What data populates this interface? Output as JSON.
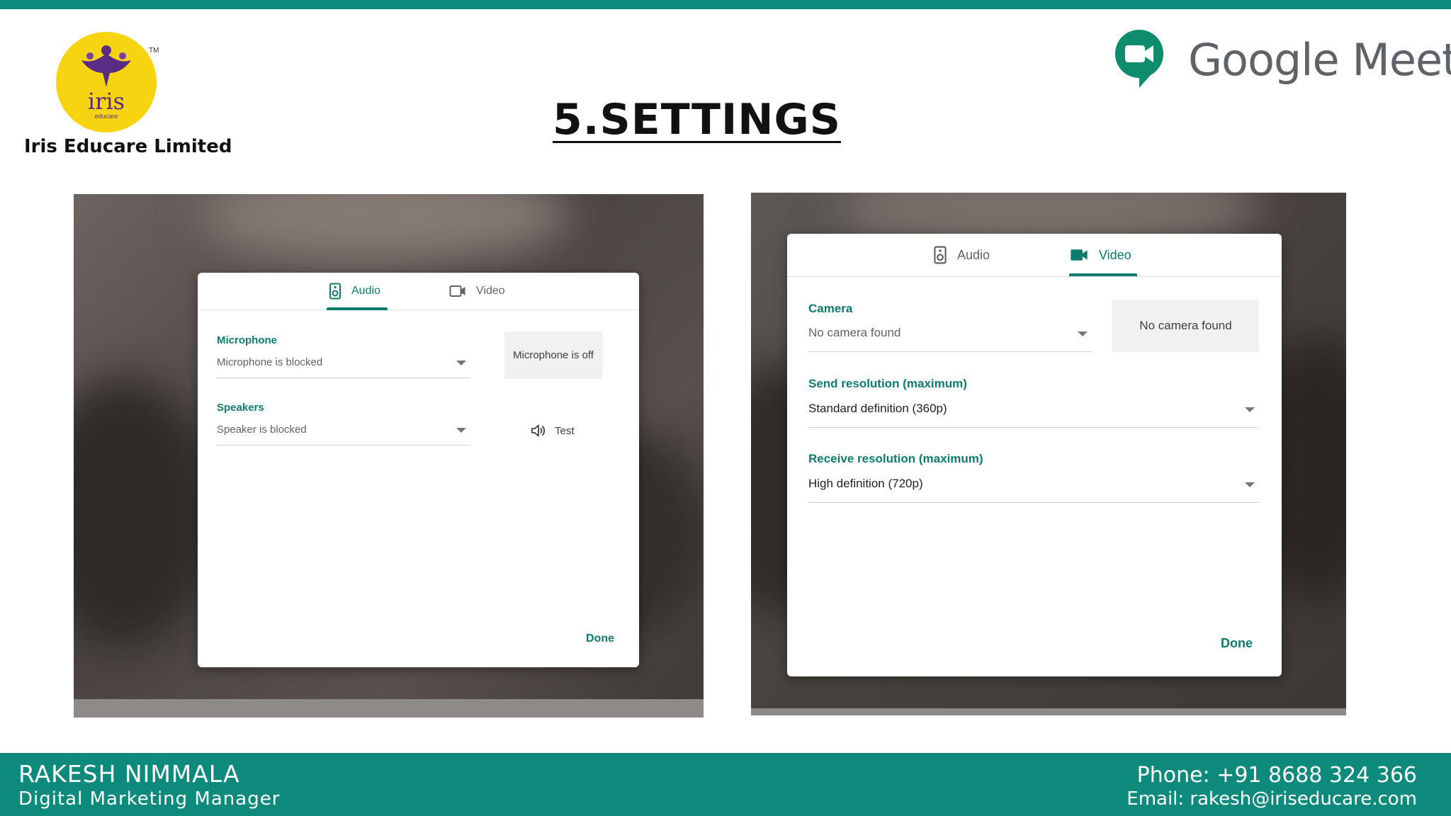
{
  "header": {
    "company_name": "Iris Educare Limited",
    "logo_word": "iris",
    "logo_sub": "educare",
    "logo_tm": "TM",
    "product_name": "Google Meet",
    "title": "5.SETTINGS"
  },
  "left_dialog": {
    "tabs": [
      {
        "label": "Audio",
        "icon": "speaker-device-icon",
        "active": true
      },
      {
        "label": "Video",
        "icon": "video-camera-icon",
        "active": false
      }
    ],
    "microphone_label": "Microphone",
    "microphone_value": "Microphone is blocked",
    "microphone_preview": "Microphone is off",
    "speakers_label": "Speakers",
    "speakers_value": "Speaker is blocked",
    "test_label": "Test",
    "done_label": "Done"
  },
  "right_dialog": {
    "tabs": [
      {
        "label": "Audio",
        "icon": "speaker-device-icon",
        "active": false
      },
      {
        "label": "Video",
        "icon": "video-camera-icon",
        "active": true
      }
    ],
    "camera_label": "Camera",
    "camera_value": "No camera found",
    "camera_preview": "No camera found",
    "send_resolution_label": "Send resolution (maximum)",
    "send_resolution_value": "Standard definition (360p)",
    "receive_resolution_label": "Receive resolution (maximum)",
    "receive_resolution_value": "High definition (720p)",
    "done_label": "Done"
  },
  "footer": {
    "name": "RAKESH NIMMALA",
    "role": "Digital Marketing Manager",
    "phone": "Phone: +91 8688 324 366",
    "email": "Email: rakesh@iriseducare.com"
  },
  "colors": {
    "brand_teal": "#0e8a7c",
    "meet_green": "#0d7c6b",
    "iris_yellow": "#f6d40f",
    "iris_purple": "#5b2c83"
  }
}
